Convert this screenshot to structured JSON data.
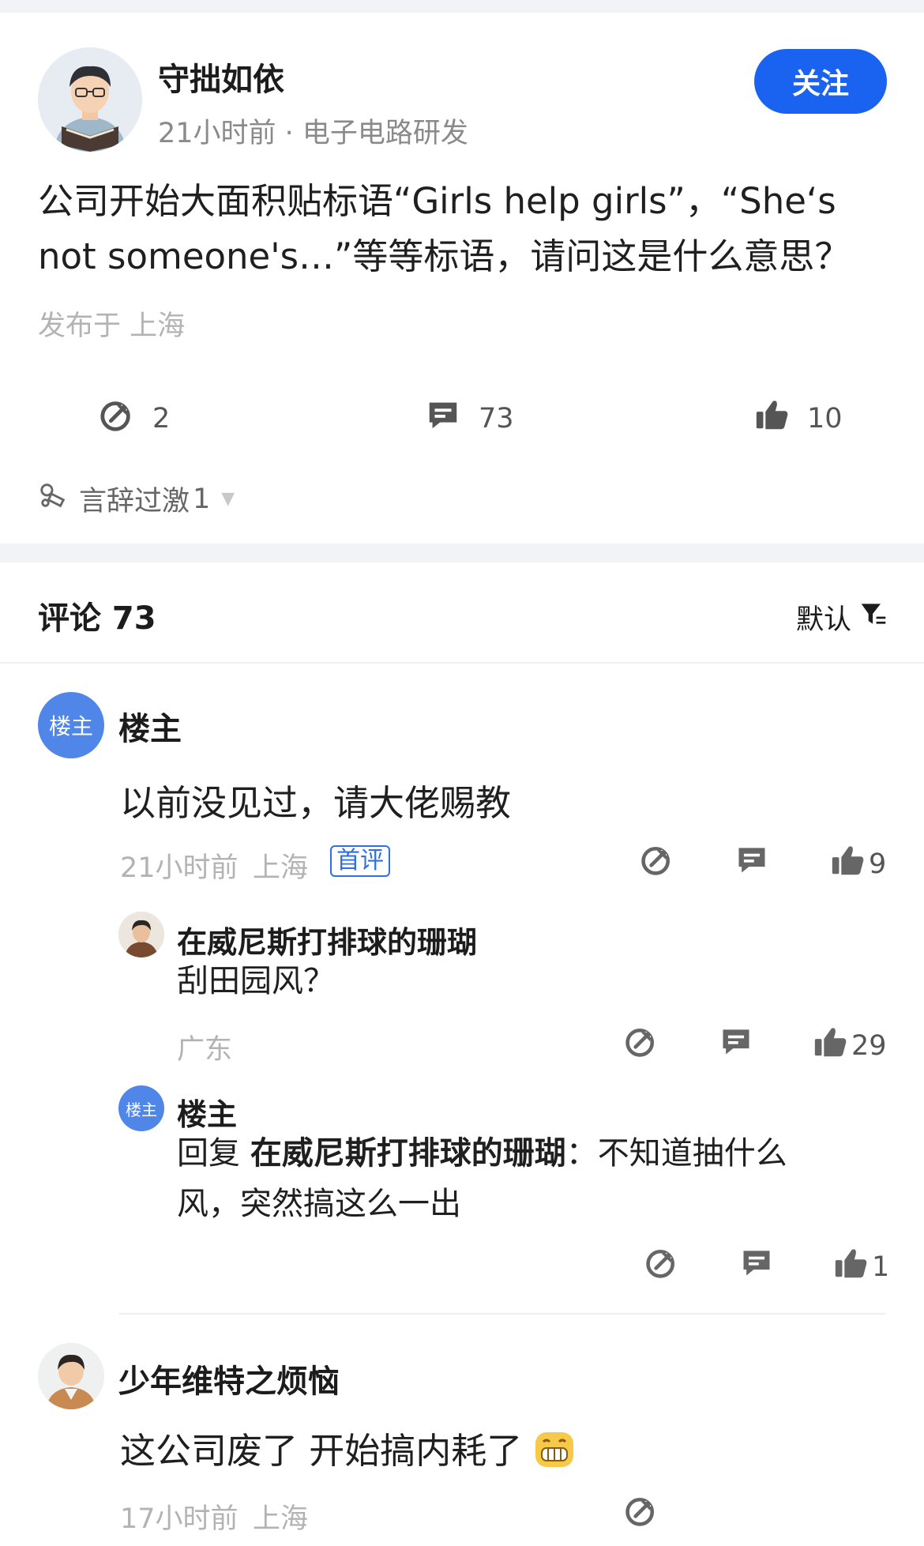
{
  "post": {
    "author": "守拙如依",
    "meta": "21小时前 · 电子电路研发",
    "follow_label": "关注",
    "title": "公司开始大面积贴标语“Girls help girls”，“She‘s not someone's…”等等标语，请问这是什么意思？",
    "location": "发布于 上海",
    "share_count": "2",
    "comment_count": "73",
    "like_count": "10",
    "tag_label": "言辞过激",
    "tag_count": "1"
  },
  "comments_header": {
    "title": "评论 73",
    "sort_label": "默认"
  },
  "comments": [
    {
      "badge": "楼主",
      "name": "楼主",
      "body": "以前没见过，请大佬赐教",
      "time": "21小时前",
      "location": "上海",
      "first_badge": "首评",
      "likes": "9",
      "replies": [
        {
          "name": "在威尼斯打排球的珊瑚",
          "body": "刮田园风？",
          "location": "广东",
          "likes": "29"
        },
        {
          "badge": "楼主",
          "name": "楼主",
          "reply_prefix": "回复",
          "reply_to": "在威尼斯打排球的珊瑚",
          "reply_colon": "：",
          "body_line1": "不知道抽什么",
          "body_line2": "风，突然搞这么一出",
          "likes": "1"
        }
      ]
    },
    {
      "name": "少年维特之烦恼",
      "body": "这公司废了 开始搞内耗了",
      "time": "17小时前",
      "location": "上海"
    }
  ],
  "colors": {
    "accent": "#1a63f0",
    "muted": "#b3b3b3",
    "badge": "#4f86e8"
  },
  "icons": [
    "share-icon",
    "comment-icon",
    "thumbs-up-icon",
    "tag-icon",
    "filter-icon",
    "grin-emoji-icon"
  ]
}
